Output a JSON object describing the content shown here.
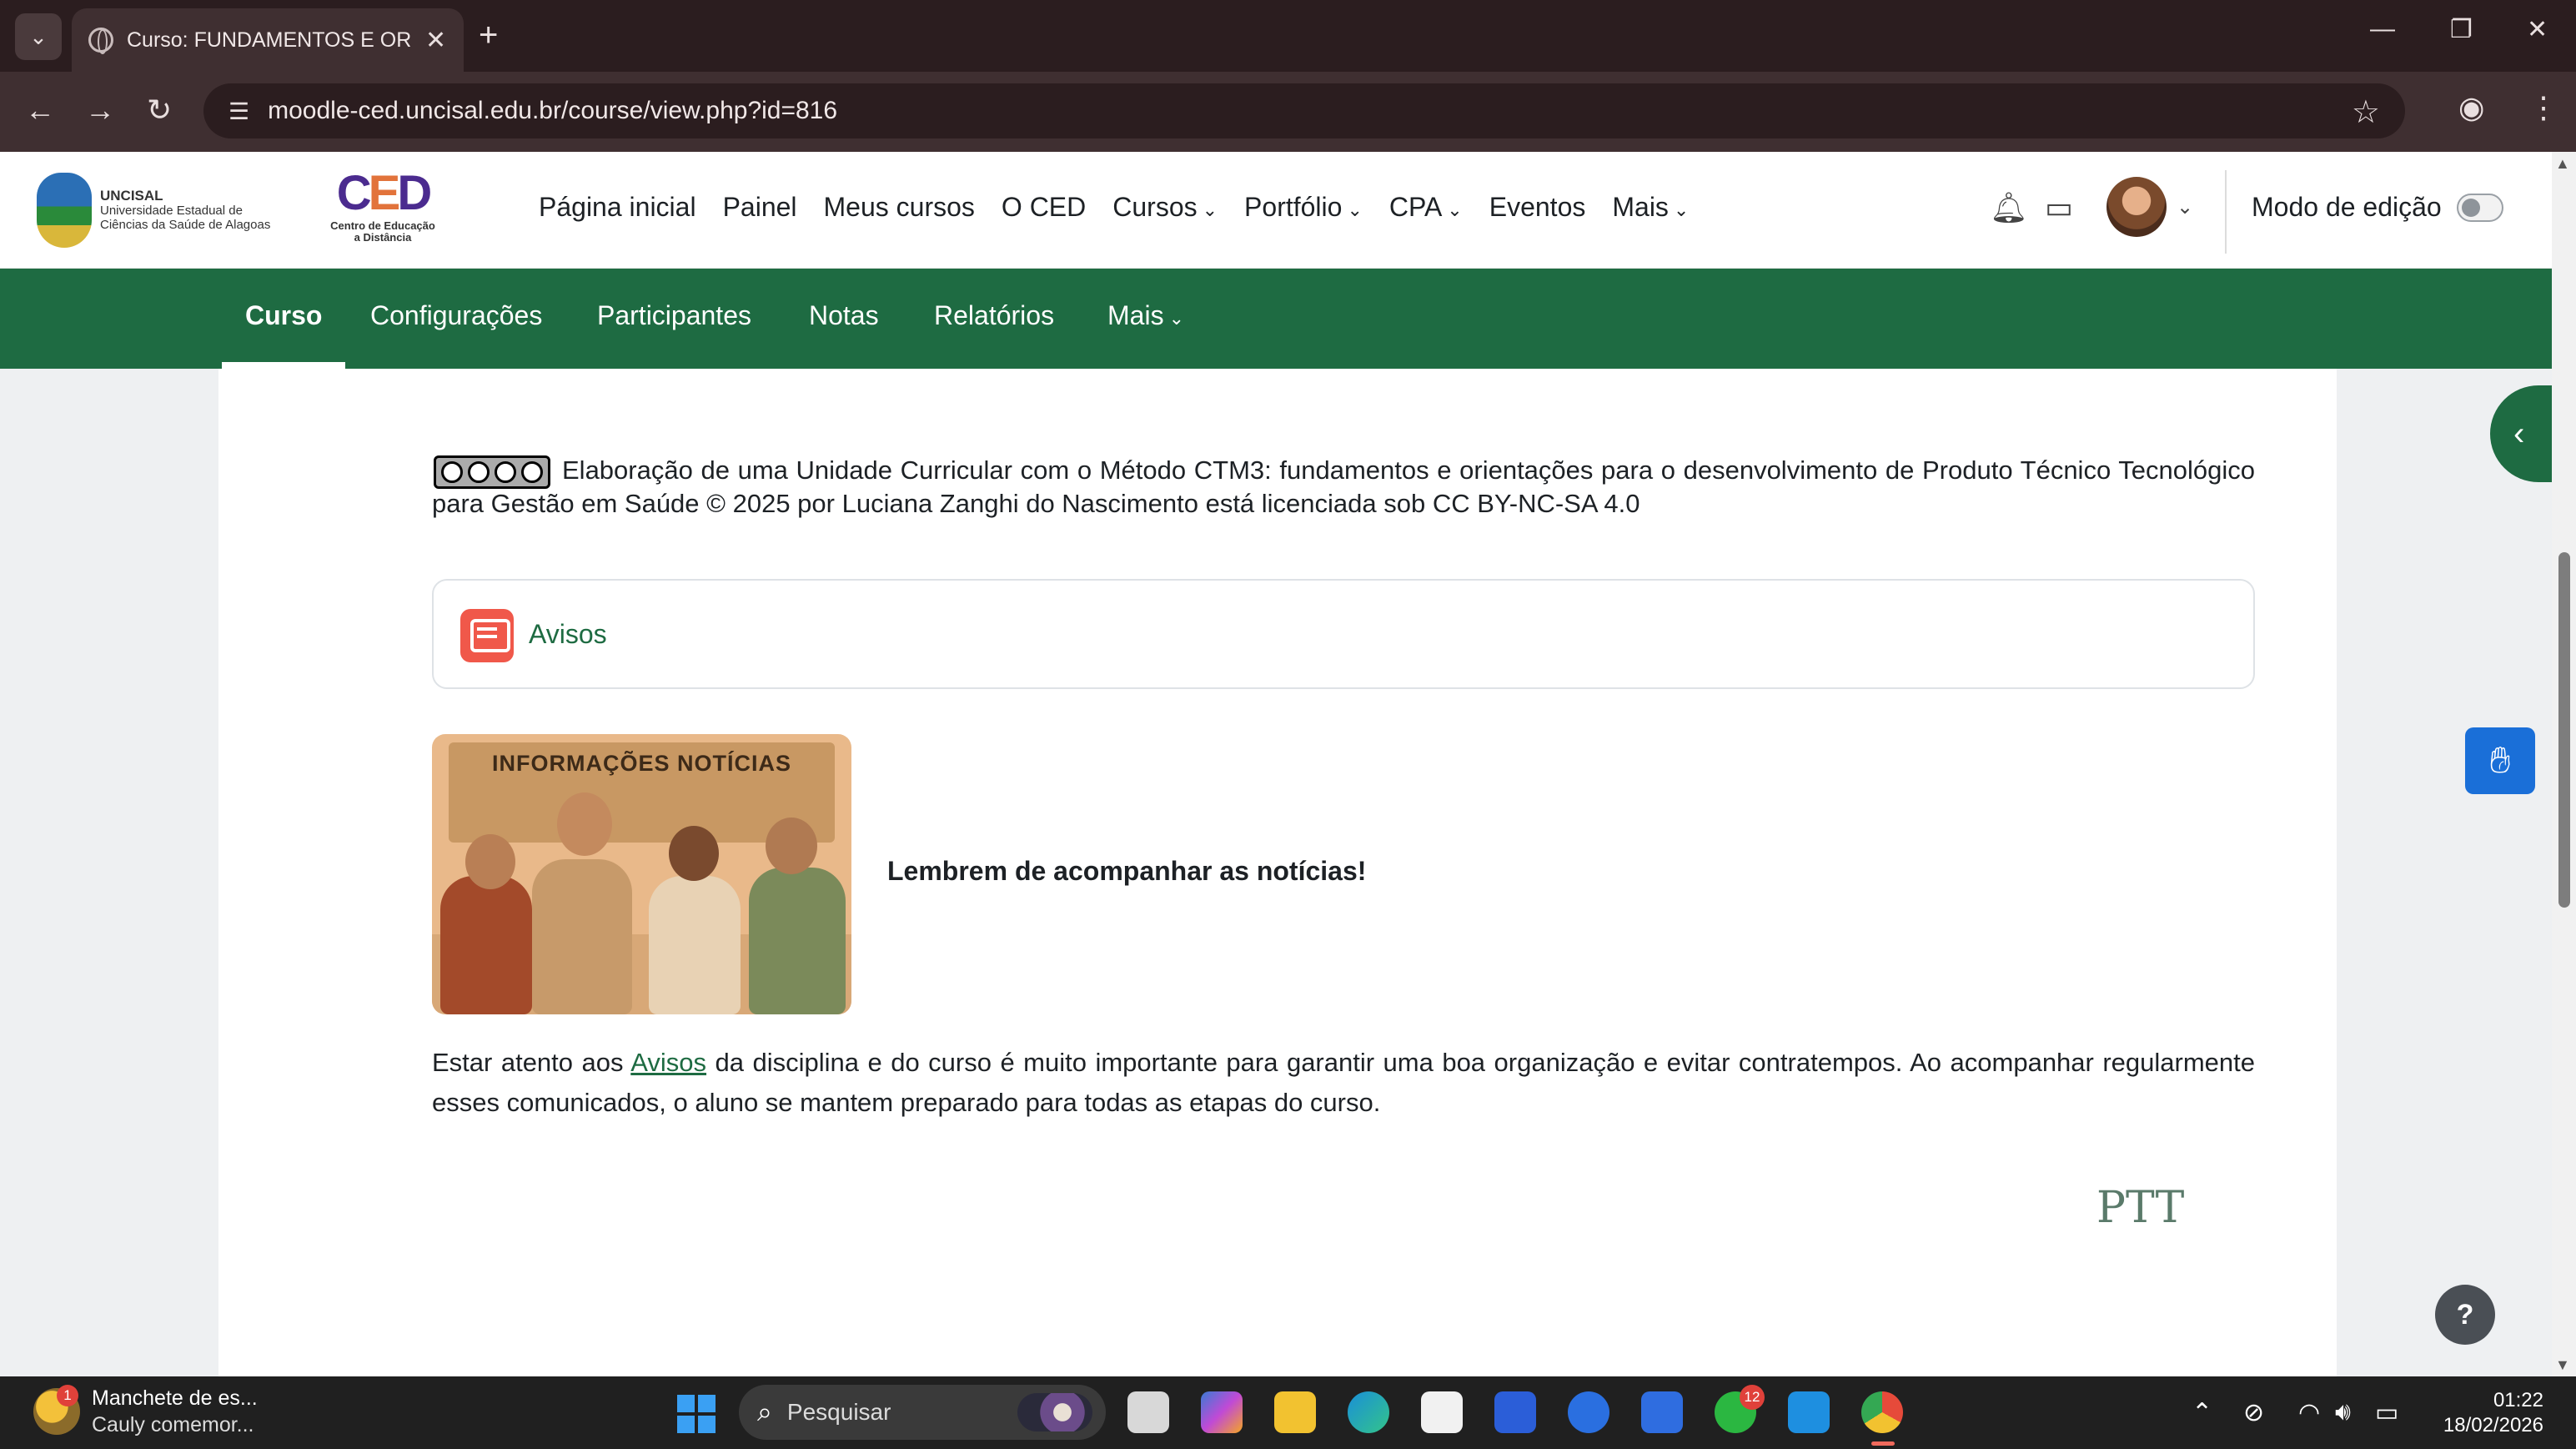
{
  "browser": {
    "tab_title": "Curso: FUNDAMENTOS E ORIEN",
    "tab_close": "✕",
    "new_tab": "+",
    "url": "moodle-ced.uncisal.edu.br/course/view.php?id=816",
    "minimize": "—",
    "restore": "❐",
    "close": "✕"
  },
  "header": {
    "uncisal_short": "UNCISAL",
    "uncisal_line1": "Universidade Estadual de",
    "uncisal_line2": "Ciências da Saúde de Alagoas",
    "ced_line1": "Centro de Educação",
    "ced_line2": "a Distância",
    "menu": [
      {
        "label": "Página inicial"
      },
      {
        "label": "Painel"
      },
      {
        "label": "Meus cursos"
      },
      {
        "label": "O CED"
      },
      {
        "label": "Cursos"
      },
      {
        "label": "Portfólio"
      },
      {
        "label": "CPA"
      },
      {
        "label": "Eventos"
      },
      {
        "label": "Mais"
      }
    ],
    "edit_mode_label": "Modo de edição"
  },
  "course_nav": {
    "items": [
      {
        "label": "Curso"
      },
      {
        "label": "Configurações"
      },
      {
        "label": "Participantes"
      },
      {
        "label": "Notas"
      },
      {
        "label": "Relatórios"
      },
      {
        "label": "Mais"
      }
    ]
  },
  "content": {
    "license_text": "Elaboração de uma Unidade Curricular com o Método CTM3: fundamentos e orientações para o desenvolvimento de Produto Técnico Tecnológico para Gestão em Saúde © 2025 por Luciana Zanghi do Nascimento está licenciada sob CC BY-NC-SA 4.0",
    "avisos_label": "Avisos",
    "image_board_text": "INFORMAÇÕES   NOTÍCIAS",
    "reminder": "Lembrem de acompanhar as notícias!",
    "para_before": "Estar atento aos ",
    "para_link": "Avisos",
    "para_after": " da disciplina e do curso é muito importante para garantir uma boa organização e evitar contratempos.  Ao acompanhar regularmente esses comunicados, o aluno se mantem preparado para todas as etapas do curso.",
    "ptt_logo": "PTT",
    "help": "?"
  },
  "taskbar": {
    "news_title": "Manchete de es...",
    "news_sub": "Cauly comemor...",
    "news_badge": "1",
    "search_placeholder": "Pesquisar",
    "whatsapp_badge": "12",
    "time": "01:22",
    "date": "18/02/2026"
  },
  "colors": {
    "brand_green": "#1e6b42",
    "browser_dark": "#2b1d1f",
    "forum_icon": "#f0584a"
  }
}
